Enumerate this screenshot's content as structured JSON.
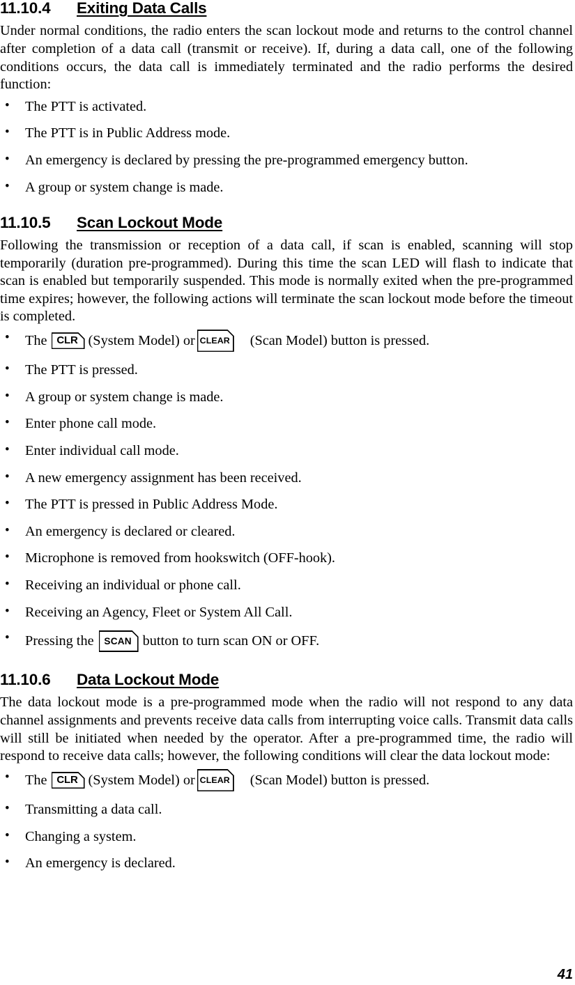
{
  "document": {
    "page_number": "41",
    "sections": [
      {
        "id": "s-11-10-4",
        "number": "11.10.4",
        "title": "Exiting Data Calls",
        "paragraph": "Under normal conditions, the radio enters the scan lockout mode and returns to the control channel after completion of a data call (transmit or receive). If, during a data call, one of the following conditions occurs, the data call is immediately terminated and the radio performs the desired function:",
        "bullets": [
          "The PTT is activated.",
          "The PTT is in Public Address mode.",
          "An emergency is declared by pressing the pre-programmed emergency button.",
          "A group or system change is made."
        ]
      },
      {
        "id": "s-11-10-5",
        "number": "11.10.5",
        "title": "Scan Lockout Mode",
        "paragraph": "Following the transmission or reception of a data call, if scan is enabled, scanning will stop temporarily (duration pre-programmed). During this time the scan LED will flash to indicate that scan is enabled but temporarily suspended. This mode is normally exited when the pre-programmed time expires; however, the following actions will terminate the scan lockout mode before the timeout is completed.",
        "bullet_keycap": {
          "prefix": "The",
          "key_clr_label": "CLR",
          "middle": "(System Model) or",
          "key_clear_label": "CLEAR",
          "suffix": "(Scan Model) button is pressed."
        },
        "bullets": [
          "The PTT is pressed.",
          "A group or system change is made.",
          "Enter phone call mode.",
          "Enter individual call mode.",
          "A new emergency assignment has been received.",
          "The PTT is pressed in Public Address Mode.",
          "An emergency is declared or cleared.",
          "Microphone is removed from hookswitch (OFF-hook).",
          "Receiving an individual or phone call.",
          "Receiving an Agency, Fleet or System All Call."
        ],
        "bullet_scan": {
          "prefix": "Pressing the",
          "key_scan_label": "SCAN",
          "suffix": "button to turn scan ON or OFF."
        }
      },
      {
        "id": "s-11-10-6",
        "number": "11.10.6",
        "title": "Data Lockout Mode",
        "paragraph": "The data lockout mode is a pre-programmed mode when the radio will not respond to any data channel assignments and prevents receive data calls from interrupting voice calls. Transmit data calls will still be initiated when needed by the operator. After a pre-programmed time, the radio will respond to receive data calls; however, the following conditions will clear the data lockout mode:",
        "bullet_keycap": {
          "prefix": "The",
          "key_clr_label": "CLR",
          "middle": "(System Model) or",
          "key_clear_label": "CLEAR",
          "suffix": "(Scan Model) button is pressed."
        },
        "bullets": [
          "Transmitting a data call.",
          "Changing a system.",
          "An emergency is declared."
        ]
      }
    ]
  }
}
